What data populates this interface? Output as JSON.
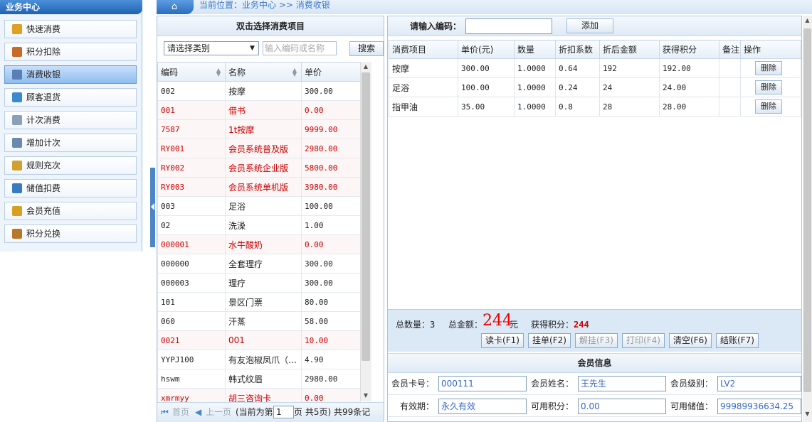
{
  "sidebar": {
    "title": "业务中心",
    "items": [
      {
        "label": "快速消费",
        "icon": "coins-icon",
        "color": "#e0a020"
      },
      {
        "label": "积分扣除",
        "icon": "gift-icon",
        "color": "#c86a2a"
      },
      {
        "label": "消费收银",
        "icon": "brush-icon",
        "color": "#5a7fb8"
      },
      {
        "label": "顾客退货",
        "icon": "return-icon",
        "color": "#3a8ad0"
      },
      {
        "label": "计次消费",
        "icon": "document-icon",
        "color": "#8aa0b8"
      },
      {
        "label": "增加计次",
        "icon": "add-document-icon",
        "color": "#6a8ab0"
      },
      {
        "label": "规则充次",
        "icon": "rule-icon",
        "color": "#d0a030"
      },
      {
        "label": "储值扣费",
        "icon": "yen-icon",
        "color": "#3a7ac0"
      },
      {
        "label": "会员充值",
        "icon": "coin-stack-icon",
        "color": "#d8a020"
      },
      {
        "label": "积分兑换",
        "icon": "exchange-icon",
        "color": "#b8782a"
      }
    ],
    "active_index": 2
  },
  "breadcrumb": {
    "text": "当前位置：业务中心 >> 消费收银"
  },
  "product_panel": {
    "title": "双击选择消费项目",
    "category_select": "请选择类别",
    "search_placeholder": "输入编码或名称",
    "search_button": "搜索",
    "columns": [
      "编码",
      "名称",
      "单价"
    ],
    "rows": [
      {
        "code": "002",
        "name": "按摩",
        "price": "300.00",
        "red": false
      },
      {
        "code": "001",
        "name": "借书",
        "price": "0.00",
        "red": true
      },
      {
        "code": "7587",
        "name": "1t按摩",
        "price": "9999.00",
        "red": true
      },
      {
        "code": "RY001",
        "name": "会员系统普及版",
        "price": "2980.00",
        "red": true
      },
      {
        "code": "RY002",
        "name": "会员系统企业版",
        "price": "5800.00",
        "red": true
      },
      {
        "code": "RY003",
        "name": "会员系统单机版",
        "price": "3980.00",
        "red": true
      },
      {
        "code": "003",
        "name": "足浴",
        "price": "100.00",
        "red": false
      },
      {
        "code": "02",
        "name": "洗澡",
        "price": "1.00",
        "red": false
      },
      {
        "code": "000001",
        "name": "水牛酸奶",
        "price": "0.00",
        "red": true
      },
      {
        "code": "000000",
        "name": "全套理疗",
        "price": "300.00",
        "red": false
      },
      {
        "code": "000003",
        "name": "理疗",
        "price": "300.00",
        "red": false
      },
      {
        "code": "101",
        "name": "景区门票",
        "price": "80.00",
        "red": false
      },
      {
        "code": "060",
        "name": "汗蒸",
        "price": "58.00",
        "red": false
      },
      {
        "code": "0021",
        "name": "001",
        "price": "10.00",
        "red": true
      },
      {
        "code": "YYPJ100",
        "name": "有友泡椒凤爪（1…",
        "price": "4.90",
        "red": false
      },
      {
        "code": "hswm",
        "name": "韩式纹眉",
        "price": "2980.00",
        "red": false
      },
      {
        "code": "xmrmyy",
        "name": "胡三咨询卡",
        "price": "0.00",
        "red": true
      }
    ],
    "pager": {
      "first": "首页",
      "prev": "上一页",
      "current_prefix": "(当前为第",
      "current_page": "1",
      "total": "页 共5页) 共99条记"
    }
  },
  "cart": {
    "code_label": "请输入编码：",
    "code_value": "",
    "add_button": "添加",
    "columns": [
      "消费项目",
      "单价(元)",
      "数量",
      "折扣系数",
      "折后金额",
      "获得积分",
      "备注",
      "操作"
    ],
    "rows": [
      {
        "item": "按摩",
        "price": "300.00",
        "qty": "1.0000",
        "discount": "0.64",
        "amount": "192",
        "points": "192.00",
        "note": "",
        "action": "删除"
      },
      {
        "item": "足浴",
        "price": "100.00",
        "qty": "1.0000",
        "discount": "0.24",
        "amount": "24",
        "points": "24.00",
        "note": "",
        "action": "删除"
      },
      {
        "item": "指甲油",
        "price": "35.00",
        "qty": "1.0000",
        "discount": "0.8",
        "amount": "28",
        "points": "28.00",
        "note": "",
        "action": "删除"
      }
    ]
  },
  "summary": {
    "qty_label": "总数量：",
    "qty_value": "3",
    "amount_label": "总金额：",
    "amount_value": "244",
    "amount_unit": "元",
    "points_label": "获得积分：",
    "points_value": "244",
    "buttons": [
      {
        "label": "读卡(F1)",
        "enabled": true
      },
      {
        "label": "挂单(F2)",
        "enabled": true
      },
      {
        "label": "解挂(F3)",
        "enabled": false
      },
      {
        "label": "打印(F4)",
        "enabled": false
      },
      {
        "label": "清空(F6)",
        "enabled": true
      },
      {
        "label": "结账(F7)",
        "enabled": true
      }
    ]
  },
  "member": {
    "title": "会员信息",
    "card_label": "会员卡号：",
    "card_value": "000111",
    "name_label": "会员姓名：",
    "name_value": "王先生",
    "level_label": "会员级别：",
    "level_value": "LV2",
    "expiry_label": "有效期：",
    "expiry_value": "永久有效",
    "points_label": "可用积分：",
    "points_value": "0.00",
    "balance_label": "可用储值：",
    "balance_value": "99989936634.25"
  },
  "colors": {
    "accent": "#2a6cc0",
    "warning_red": "#cc0000"
  }
}
